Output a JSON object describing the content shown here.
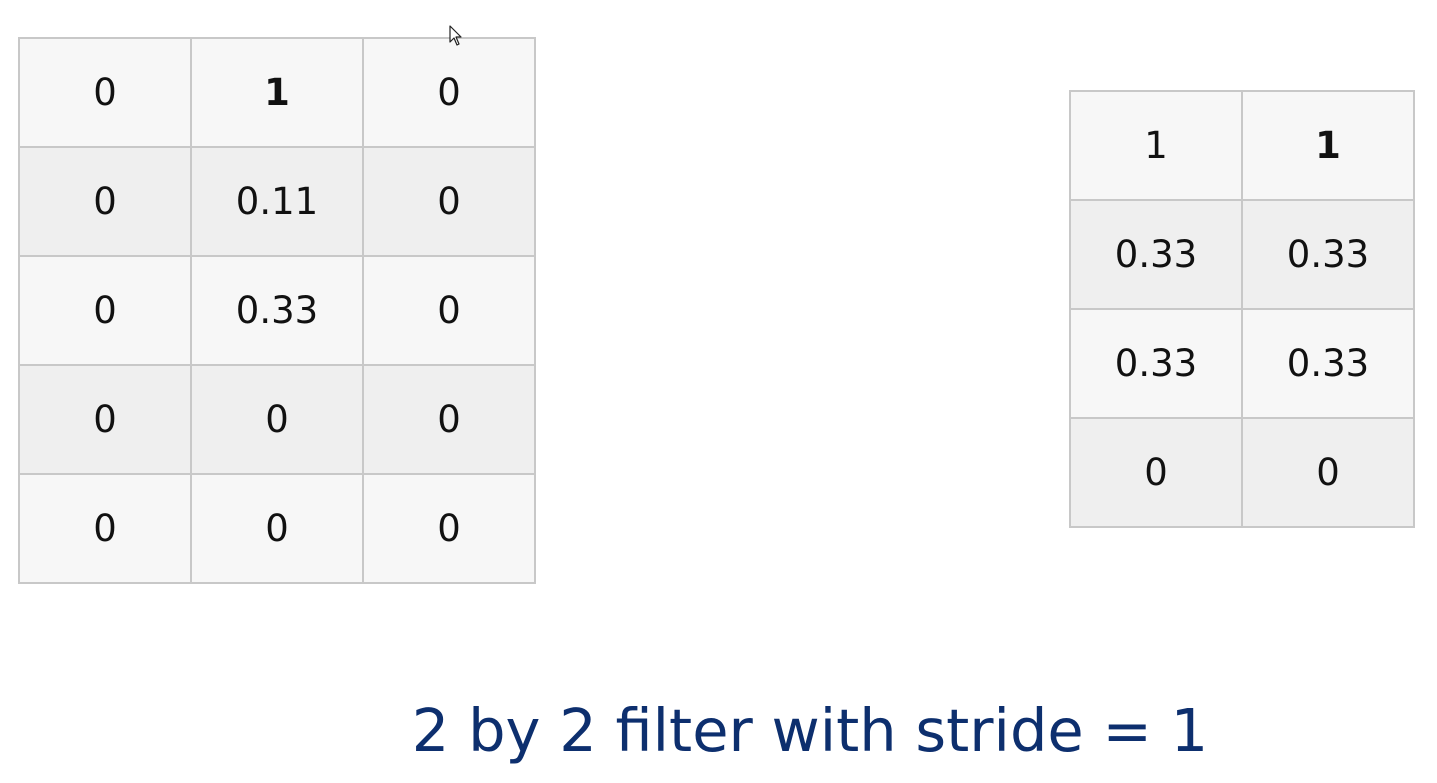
{
  "input_matrix": {
    "rows": [
      [
        "0",
        "1",
        "0"
      ],
      [
        "0",
        "0.11",
        "0"
      ],
      [
        "0",
        "0.33",
        "0"
      ],
      [
        "0",
        "0",
        "0"
      ],
      [
        "0",
        "0",
        "0"
      ]
    ]
  },
  "output_matrix": {
    "rows": [
      [
        "1",
        "1"
      ],
      [
        "0.33",
        "0.33"
      ],
      [
        "0.33",
        "0.33"
      ],
      [
        "0",
        "0"
      ]
    ]
  },
  "caption": "2 by 2 filter with stride = 1",
  "colors": {
    "caption": "#0d2f6e",
    "grid_line": "#c8c8c8",
    "cell_light": "#f7f7f7",
    "cell_dark": "#efefef"
  }
}
